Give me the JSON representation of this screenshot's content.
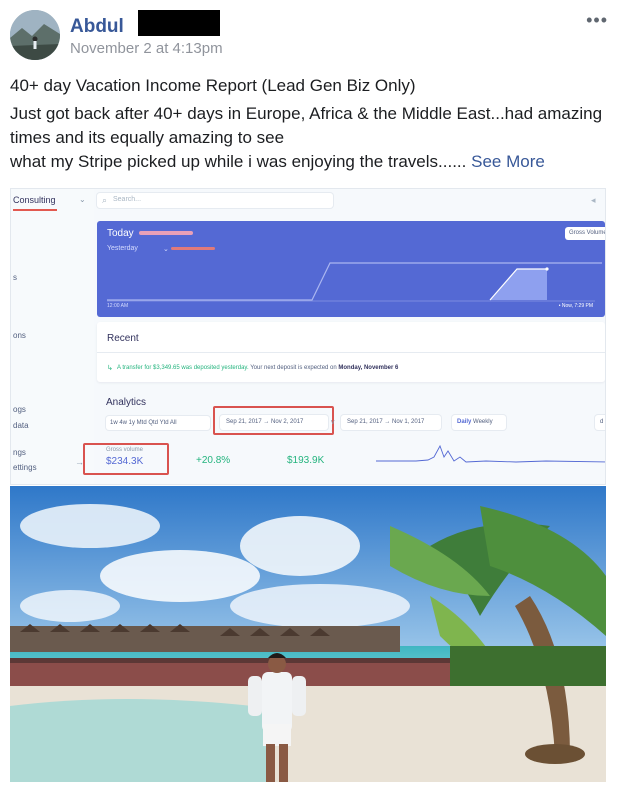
{
  "post": {
    "author": "Abdul",
    "timestamp": "November 2 at 4:13pm",
    "more_label": "•••",
    "title": "40+ day Vacation Income Report (Lead Gen Biz Only)",
    "body_line1": "Just got back after 40+ days in Europe, Africa & the Middle East...had amazing times and its equally amazing to see",
    "body_line2": "what my Stripe picked up while i was enjoying the travels......",
    "see_more": "See More"
  },
  "stripe": {
    "account": "Consulting",
    "sidebar_items": [
      "s",
      "ons",
      "ogs",
      "data",
      "ngs",
      "ettings"
    ],
    "search_placeholder": "Search...",
    "today": {
      "label": "Today",
      "yesterday_label": "Yesterday",
      "gross_button": "Gross Volume",
      "axis_start": "12:00 AM",
      "axis_end": "• Now, 7:29 PM"
    },
    "recent": {
      "title": "Recent",
      "transfer_prefix": "A transfer for $3,349.65 was deposited yesterday.",
      "transfer_middle": "Your next deposit is expected on",
      "transfer_date": "Monday, November 6"
    },
    "analytics": {
      "title": "Analytics",
      "ranges": "1w  4w  1y  Mtd  Qtd  Ytd  All",
      "date_range": "Sep 21, 2017 → Nov 2, 2017",
      "vs": "v",
      "compare_range": "Sep 21, 2017 → Nov 1, 2017",
      "interval_selected": "Daily",
      "interval_other": "Weekly",
      "extra": "d",
      "gross_volume_label": "Gross volume",
      "gross_volume_value": "$234.3K",
      "change": "+20.8%",
      "previous": "$193.9K",
      "arrow": "→"
    }
  },
  "colors": {
    "link": "#385898",
    "stripe_blurple": "#5469d4",
    "stripe_green": "#24b47e",
    "highlight_red": "#d9534f"
  },
  "icons": [
    "search-icon",
    "speaker-icon",
    "more-icon",
    "transfer-icon",
    "chevron-down-icon"
  ]
}
